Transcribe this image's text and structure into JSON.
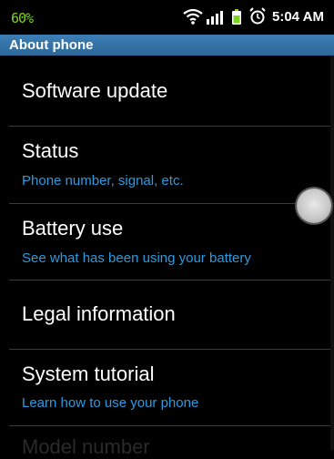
{
  "status_bar": {
    "battery_percent": "60%",
    "time": "5:04 AM",
    "icons": [
      "wifi-icon",
      "signal-icon",
      "battery-icon",
      "alarm-icon"
    ],
    "battery_color": "#7ed321"
  },
  "header": {
    "title": "About phone"
  },
  "items": [
    {
      "title": "Software update",
      "subtitle": ""
    },
    {
      "title": "Status",
      "subtitle": "Phone number, signal, etc."
    },
    {
      "title": "Battery use",
      "subtitle": "See what has been using your battery"
    },
    {
      "title": "Legal information",
      "subtitle": ""
    },
    {
      "title": "System tutorial",
      "subtitle": "Learn how to use your phone"
    },
    {
      "title": "Model number",
      "subtitle": ""
    }
  ],
  "colors": {
    "title_bar": "#3d7fb5",
    "subtitle": "#2b9be0",
    "background": "#000000"
  }
}
